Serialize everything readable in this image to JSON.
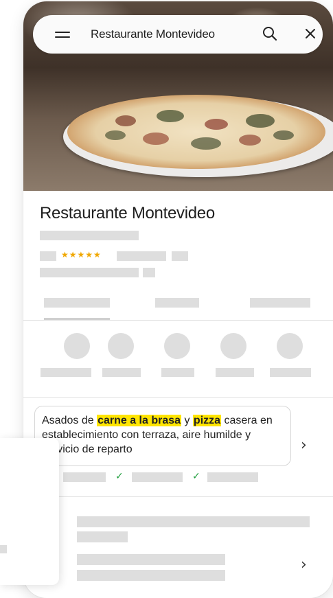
{
  "search": {
    "query": "Restaurante Montevideo"
  },
  "place": {
    "name": "Restaurante Montevideo",
    "rating_stars": "★★★★★"
  },
  "description": {
    "pre": "Asados de ",
    "highlight1": "carne a la brasa",
    "mid": " y ",
    "highlight2": "pizza",
    "post": " casera en establecimiento con terraza, aire humilde y servicio de reparto"
  },
  "icons": {
    "menu": "menu-icon",
    "search": "search-icon",
    "close": "close-icon",
    "chevron": "›",
    "check": "✓"
  },
  "colors": {
    "highlight": "#ffe500",
    "star": "#f0a800",
    "check": "#1e9e3c",
    "skeleton": "#dedede"
  }
}
